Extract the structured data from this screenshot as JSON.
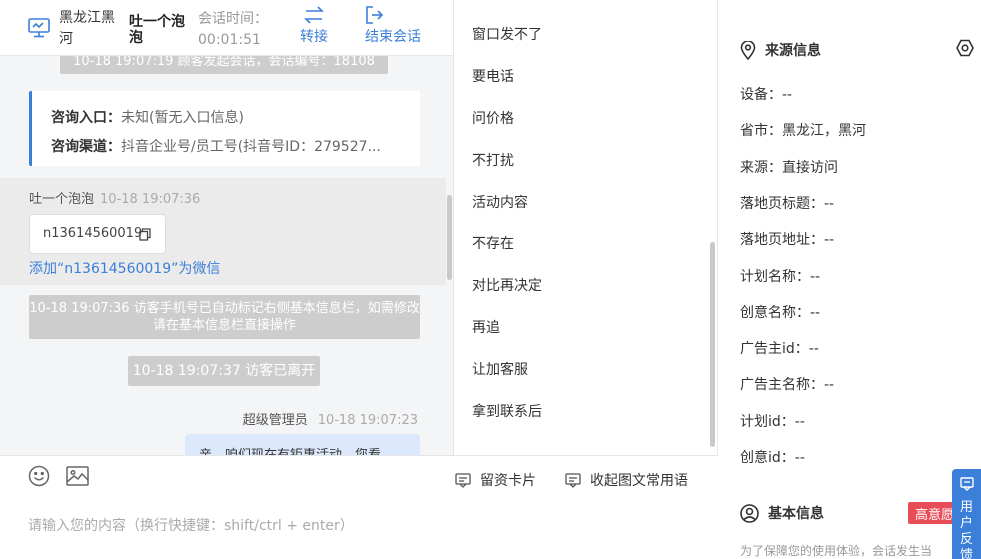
{
  "header": {
    "location": "黑龙江黑河",
    "visitor_name": "吐一个泡泡",
    "session_time_label": "会话时间：",
    "session_time": "00:01:51",
    "transfer_label": "转接",
    "end_session_label": "结束会话"
  },
  "chat": {
    "system_msg_1": "10-18 19:07:19 顾客发起会话，会话编号：18108",
    "inquiry_entry_label": "咨询入口：",
    "inquiry_entry_value": "未知(暂无入口信息)",
    "inquiry_channel_label": "咨询渠道：",
    "inquiry_channel_value": "抖音企业号/员工号(抖音号ID：279527...",
    "visitor_name": "吐一个泡泡",
    "visitor_time": "10-18 19:07:36",
    "phone_number": "n13614560019",
    "add_wechat": "添加“n13614560019”为微信",
    "system_msg_2": "10-18 19:07:36 访客手机号已自动标记右侧基本信息栏，如需修改请在基本信息栏直接操作",
    "system_msg_3": "10-18 19:07:37 访客已离开",
    "agent_name": "超级管理员",
    "agent_time": "10-18 19:07:23",
    "agent_message": "亲，咱们现在有钜惠活动，您看"
  },
  "phrases": [
    "窗口发不了",
    "要电话",
    "问价格",
    "不打扰",
    "活动内容",
    "不存在",
    "对比再决定",
    "再追",
    "让加客服",
    "拿到联系后"
  ],
  "composer": {
    "lead_card_label": "留资卡片",
    "collapse_label": "收起图文常用语",
    "placeholder": "请输入您的内容（换行快捷键：shift/ctrl + enter）"
  },
  "source_info": {
    "title": "来源信息",
    "rows": [
      "设备：--",
      "省市：黑龙江，黑河",
      "来源：直接访问",
      "落地页标题：--",
      "落地页地址：--",
      "计划名称：--",
      "创意名称：--",
      "广告主id：--",
      "广告主名称：--",
      "计划id：--",
      "创意id：--"
    ]
  },
  "basic_info": {
    "title": "基本信息",
    "badge": "高意愿",
    "note": "为了保障您的使用体验，会话发生当"
  },
  "feedback_label": "用户反馈",
  "colors": {
    "accent": "#3b7fd8",
    "badge_red": "#e84d57",
    "system_pill": "#cdcdcd",
    "agent_bubble": "#dce8fb"
  },
  "icons": [
    "monitor-icon",
    "transfer-icon",
    "exit-icon",
    "copy-icon",
    "emoji-icon",
    "image-icon",
    "card-icon",
    "message-icon",
    "location-pin-icon",
    "settings-icon",
    "user-circle-icon",
    "feedback-icon"
  ]
}
